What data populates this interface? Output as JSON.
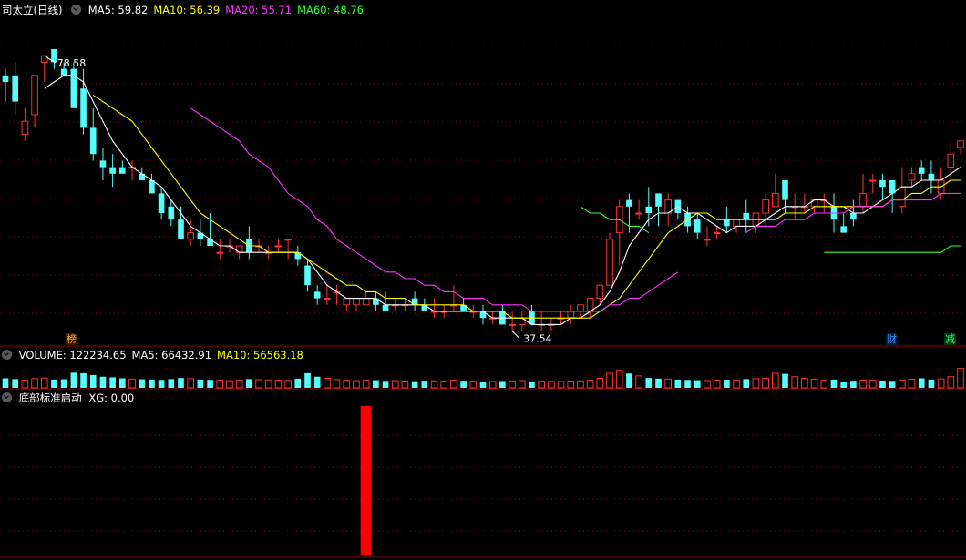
{
  "main_panel": {
    "stock_name": "司太立(日线)",
    "ma_labels": [
      {
        "text": "MA5: 59.82",
        "color": "#ffffff"
      },
      {
        "text": "MA10: 56.39",
        "color": "#ffff00"
      },
      {
        "text": "MA20: 55.71",
        "color": "#ff33ff"
      },
      {
        "text": "MA60: 48.76",
        "color": "#33ff33"
      }
    ],
    "high_label": "78.58",
    "low_label": "37.54",
    "markers": {
      "bang": "榜",
      "cai": "财",
      "jian": "减"
    }
  },
  "volume_panel": {
    "labels": [
      {
        "text": "VOLUME: 122234.65",
        "color": "#ffffff"
      },
      {
        "text": "MA5: 66432.91",
        "color": "#ffffff"
      },
      {
        "text": "MA10: 56563.18",
        "color": "#ffff00"
      }
    ]
  },
  "indicator_panel": {
    "title": "底部标准启动",
    "value_label": "XG: 0.00",
    "signal_color": "#ff0000"
  },
  "colors": {
    "up": "#ff3232",
    "down": "#54fcfc",
    "ma5": "#ffffff",
    "ma10": "#ffff00",
    "ma20": "#ff33ff",
    "ma60": "#33ff33",
    "grid": "#8b0000"
  },
  "chart_data": [
    {
      "type": "candlestick",
      "title": "司太立(日线)",
      "price_range": [
        35,
        85
      ],
      "open": [
        76,
        76,
        67,
        70,
        78,
        80,
        77,
        77,
        74,
        68,
        63,
        62,
        62,
        62,
        61,
        60,
        58,
        56,
        54,
        51,
        52,
        51,
        49,
        50,
        49,
        51,
        50,
        49,
        50,
        51,
        49,
        47,
        43,
        42,
        43,
        41,
        41,
        41,
        42,
        41,
        41,
        41,
        42,
        41,
        40,
        40,
        41,
        41,
        40,
        40,
        39,
        40,
        38,
        38,
        40,
        38,
        38,
        39,
        39,
        40,
        40,
        42,
        44,
        52,
        57,
        55,
        56,
        58,
        55,
        57,
        55,
        54,
        51,
        52,
        54,
        53,
        55,
        53,
        55,
        56,
        60,
        56,
        56,
        56,
        57,
        56,
        53,
        55,
        56,
        60,
        60,
        60,
        56,
        60,
        62,
        61,
        58,
        62,
        65
      ],
      "high": [
        77,
        78,
        71,
        72,
        79,
        79,
        78,
        78,
        77,
        71,
        65,
        64,
        63,
        63,
        62,
        61,
        59,
        57,
        56,
        54,
        54,
        55,
        51,
        51,
        50,
        53,
        51,
        50,
        51,
        51,
        50,
        48,
        44,
        44,
        44,
        42,
        42,
        43,
        43,
        43,
        42,
        42,
        43,
        42,
        42,
        41,
        44,
        42,
        41,
        41,
        40,
        41,
        40,
        40,
        41,
        40,
        39,
        40,
        41,
        41,
        42,
        44,
        52,
        57,
        58,
        57,
        59,
        57,
        58,
        57,
        56,
        55,
        53,
        53,
        56,
        54,
        57,
        55,
        58,
        61,
        60,
        58,
        58,
        57,
        58,
        58,
        55,
        57,
        61,
        61,
        61,
        60,
        62,
        62,
        63,
        63,
        62,
        66,
        66
      ],
      "low": [
        72,
        70,
        66,
        68,
        75,
        77,
        76,
        71,
        67,
        63,
        60,
        59,
        61,
        60,
        60,
        58,
        54,
        53,
        51,
        50,
        50,
        50,
        48,
        49,
        48,
        48,
        49,
        48,
        49,
        48,
        47,
        43,
        41,
        41,
        41,
        40,
        40,
        41,
        40,
        40,
        40,
        40,
        40,
        40,
        39,
        39,
        40,
        40,
        39,
        38,
        38,
        38,
        37,
        37,
        38,
        37,
        37,
        38,
        38,
        39,
        39,
        41,
        44,
        47,
        52,
        54,
        53,
        53,
        53,
        54,
        52,
        51,
        50,
        51,
        52,
        52,
        52,
        52,
        53,
        56,
        55,
        54,
        55,
        55,
        55,
        52,
        52,
        53,
        55,
        58,
        57,
        55,
        55,
        59,
        60,
        58,
        57,
        60,
        64
      ],
      "close": [
        75,
        72,
        69,
        76,
        79,
        78,
        76,
        71,
        68,
        64,
        62,
        61,
        61,
        62,
        60,
        58,
        55,
        54,
        51,
        52,
        51,
        50,
        49,
        50,
        50,
        49,
        50,
        49,
        50,
        51,
        48,
        44,
        42,
        42,
        43,
        42,
        42,
        42,
        41,
        40,
        41,
        41,
        41,
        40,
        40,
        40,
        41,
        40,
        40,
        39,
        39,
        38,
        38,
        39,
        38,
        38,
        38,
        39,
        40,
        41,
        42,
        44,
        51,
        56,
        56,
        55,
        55,
        56,
        57,
        55,
        53,
        52,
        51,
        52,
        53,
        54,
        54,
        55,
        57,
        58,
        57,
        56,
        56,
        57,
        57,
        54,
        52,
        54,
        58,
        60,
        59,
        58,
        59,
        61,
        61,
        60,
        60,
        64,
        66
      ]
    },
    {
      "type": "line",
      "title": "Moving averages",
      "series": [
        {
          "name": "MA5",
          "values": [
            null,
            null,
            null,
            null,
            74,
            75,
            76,
            76,
            75,
            72,
            69,
            66,
            64,
            62,
            61,
            60,
            59,
            57,
            55,
            53,
            52,
            51,
            50,
            50,
            49,
            49,
            49,
            49,
            49,
            49,
            49,
            48,
            46,
            44,
            43,
            42,
            42,
            42,
            42,
            41,
            41,
            41,
            41,
            41,
            40,
            40,
            40,
            40,
            40,
            40,
            39,
            39,
            39,
            39,
            38,
            38,
            38,
            38,
            39,
            39,
            40,
            41,
            43,
            46,
            50,
            52,
            54,
            55,
            55,
            56,
            55,
            55,
            54,
            53,
            52,
            53,
            53,
            53,
            54,
            55,
            56,
            56,
            56,
            57,
            57,
            56,
            56,
            55,
            55,
            56,
            57,
            58,
            59,
            59,
            60,
            60,
            60,
            61,
            62
          ]
        },
        {
          "name": "MA10",
          "values": [
            null,
            null,
            null,
            null,
            null,
            null,
            null,
            null,
            null,
            73,
            72,
            71,
            70,
            69,
            67,
            65,
            63,
            61,
            59,
            57,
            55,
            54,
            53,
            52,
            51,
            50,
            50,
            49,
            49,
            49,
            49,
            48,
            47,
            46,
            45,
            44,
            44,
            43,
            43,
            42,
            42,
            42,
            41,
            41,
            41,
            41,
            41,
            41,
            40,
            40,
            40,
            40,
            39,
            39,
            39,
            39,
            39,
            39,
            39,
            39,
            39,
            40,
            41,
            42,
            44,
            46,
            48,
            50,
            52,
            53,
            54,
            55,
            55,
            54,
            54,
            54,
            54,
            54,
            54,
            54,
            55,
            55,
            55,
            56,
            56,
            56,
            56,
            56,
            56,
            56,
            56,
            57,
            57,
            58,
            58,
            59,
            59,
            60,
            60
          ]
        },
        {
          "name": "MA20",
          "values": [
            null,
            null,
            null,
            null,
            null,
            null,
            null,
            null,
            null,
            null,
            null,
            null,
            null,
            null,
            null,
            null,
            null,
            null,
            null,
            71,
            70,
            69,
            68,
            67,
            66,
            64,
            63,
            62,
            60,
            58,
            57,
            56,
            54,
            53,
            51,
            50,
            49,
            48,
            47,
            46,
            46,
            45,
            45,
            44,
            44,
            43,
            43,
            42,
            42,
            42,
            41,
            41,
            41,
            41,
            40,
            40,
            40,
            40,
            40,
            40,
            40,
            40,
            41,
            41,
            42,
            42,
            43,
            44,
            45,
            46,
            null,
            null,
            null,
            null,
            null,
            null,
            52,
            53,
            53,
            53,
            54,
            54,
            54,
            55,
            55,
            55,
            55,
            56,
            56,
            56,
            56,
            57,
            57,
            57,
            57,
            57,
            58,
            58,
            58
          ]
        },
        {
          "name": "MA60",
          "values": [
            null,
            null,
            null,
            null,
            null,
            null,
            null,
            null,
            null,
            null,
            null,
            null,
            null,
            null,
            null,
            null,
            null,
            null,
            null,
            null,
            null,
            null,
            null,
            null,
            null,
            null,
            null,
            null,
            null,
            null,
            null,
            null,
            null,
            null,
            null,
            null,
            null,
            null,
            null,
            null,
            null,
            null,
            null,
            null,
            null,
            null,
            null,
            null,
            null,
            null,
            null,
            null,
            null,
            null,
            null,
            null,
            null,
            null,
            null,
            56,
            55,
            55,
            54,
            54,
            53,
            53,
            52,
            null,
            null,
            null,
            null,
            null,
            null,
            null,
            null,
            null,
            null,
            null,
            null,
            null,
            null,
            null,
            null,
            null,
            49,
            49,
            49,
            49,
            49,
            49,
            49,
            49,
            49,
            49,
            49,
            49,
            49,
            50,
            50
          ]
        }
      ]
    },
    {
      "type": "bar",
      "title": "VOLUME",
      "ylim": [
        0,
        160000
      ],
      "values": [
        60000,
        55000,
        50000,
        58000,
        62000,
        52000,
        54000,
        95000,
        92000,
        80000,
        70000,
        66000,
        60000,
        55000,
        54000,
        52000,
        50000,
        55000,
        62000,
        58000,
        52000,
        50000,
        48000,
        45000,
        50000,
        55000,
        52000,
        50000,
        48000,
        46000,
        58000,
        92000,
        70000,
        60000,
        52000,
        48000,
        45000,
        50000,
        48000,
        44000,
        46000,
        43000,
        42000,
        45000,
        44000,
        42000,
        48000,
        45000,
        42000,
        40000,
        41000,
        43000,
        44000,
        46000,
        40000,
        42000,
        41000,
        40000,
        43000,
        44000,
        48000,
        60000,
        92000,
        110000,
        90000,
        75000,
        62000,
        58000,
        55000,
        52000,
        50000,
        48000,
        46000,
        48000,
        52000,
        50000,
        55000,
        58000,
        60000,
        92000,
        88000,
        70000,
        60000,
        55000,
        50000,
        52000,
        40000,
        45000,
        48000,
        50000,
        46000,
        44000,
        50000,
        55000,
        60000,
        52000,
        56000,
        70000,
        122234
      ]
    },
    {
      "type": "bar",
      "title": "底部标准启动",
      "categories": [
        "XG"
      ],
      "values": [
        1
      ],
      "signal_index": 37
    }
  ]
}
